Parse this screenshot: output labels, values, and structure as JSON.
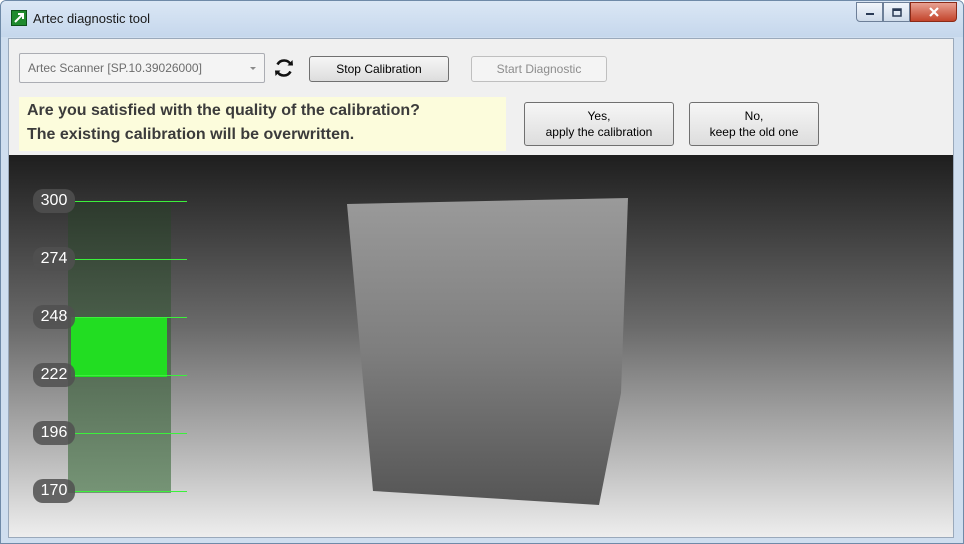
{
  "window": {
    "title": "Artec diagnostic tool",
    "caption_buttons": [
      "minimize-icon",
      "maximize-icon",
      "close-icon"
    ]
  },
  "toolbar": {
    "scanner_select": {
      "value": "Artec Scanner [SP.10.39026000]"
    },
    "refresh_icon": "refresh-icon",
    "stop_button_label": "Stop Calibration",
    "start_button_label": "Start Diagnostic"
  },
  "question": {
    "line1": "Are you satisfied with the quality of the calibration?",
    "line2": "The existing calibration will be overwritten."
  },
  "buttons": {
    "yes_line1": "Yes,",
    "yes_line2": "apply the calibration",
    "no_line1": "No,",
    "no_line2": "keep the old one"
  },
  "distance_gauge": {
    "ticks": [
      "300",
      "274",
      "248",
      "222",
      "196",
      "170"
    ],
    "fill_range": [
      221,
      248
    ],
    "accent_color": "#22dd22"
  }
}
